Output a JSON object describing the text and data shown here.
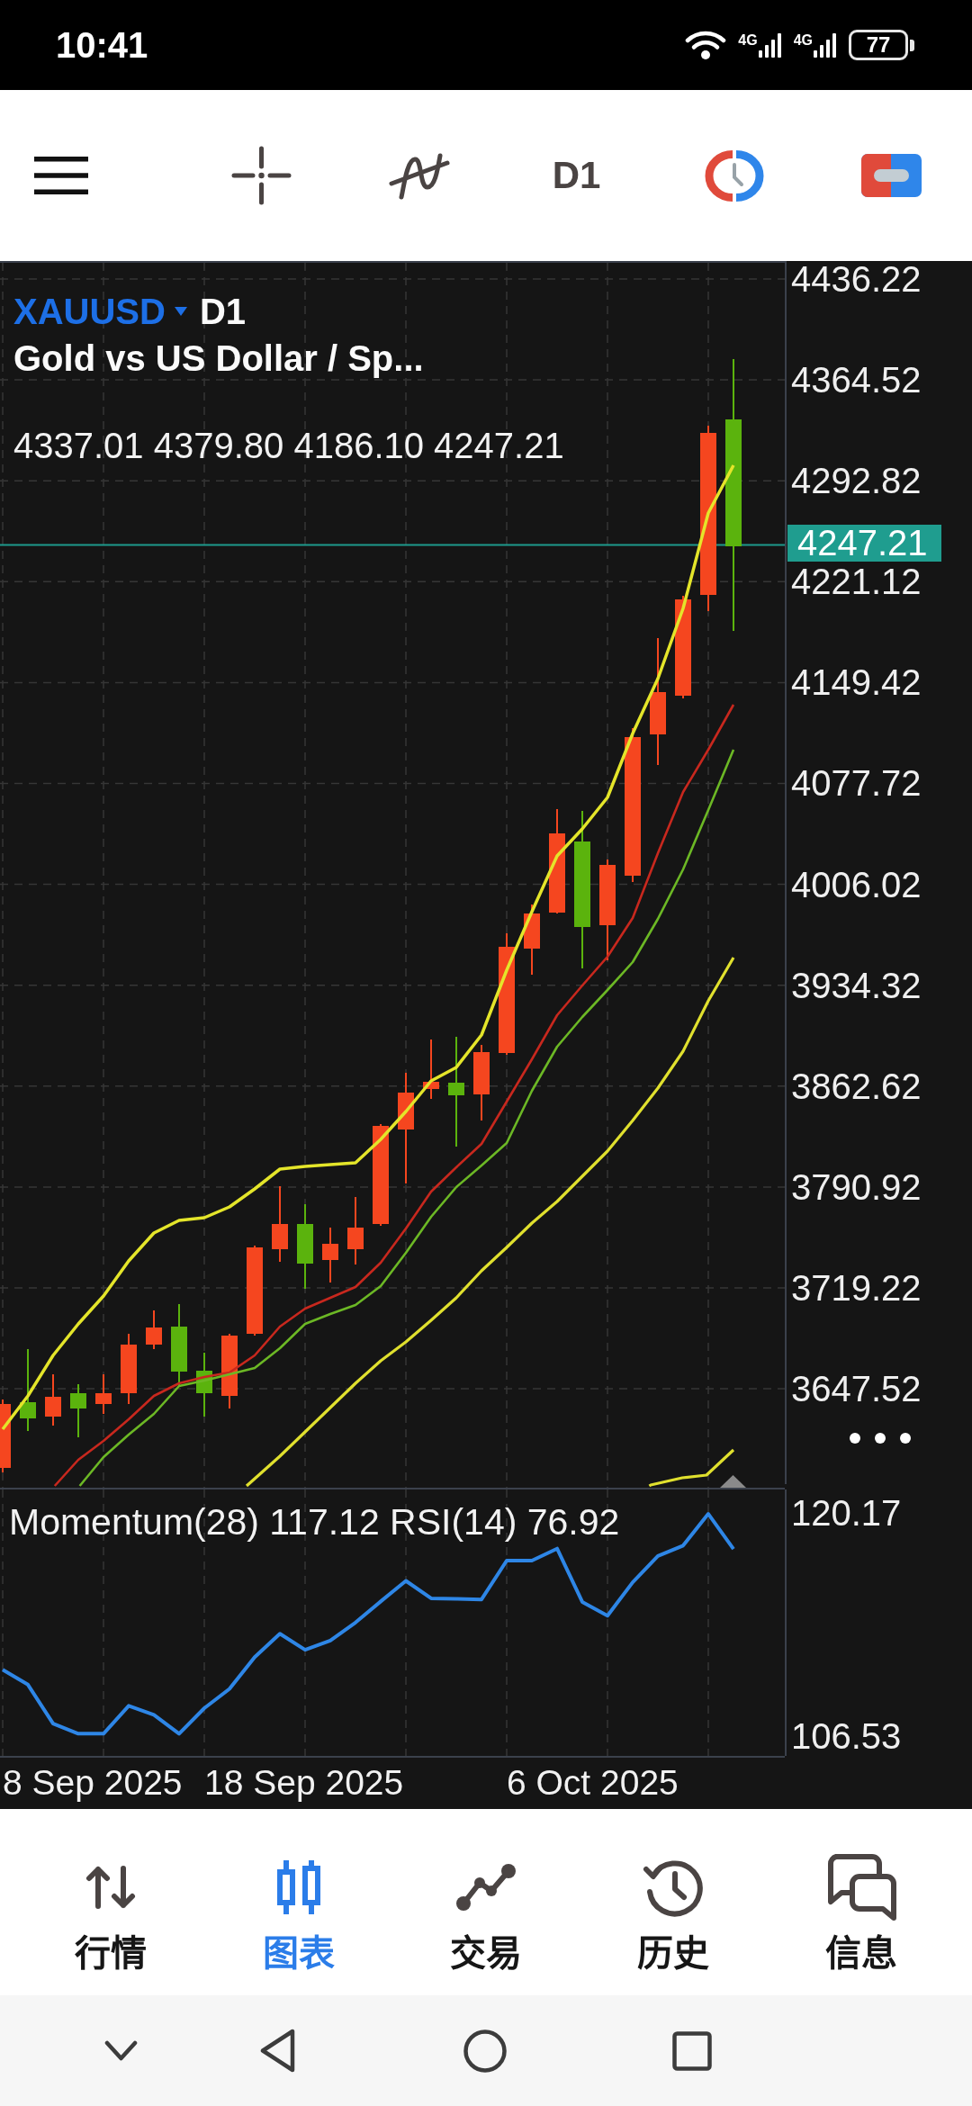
{
  "status_bar": {
    "time": "10:41",
    "signals": [
      {
        "network": "4G"
      },
      {
        "network": "4G"
      }
    ],
    "battery": "77"
  },
  "toolbar": {
    "timeframe": "D1"
  },
  "chart": {
    "symbol": "XAUUSD",
    "timeframe": "D1",
    "description": "Gold vs US Dollar / Sp...",
    "ohlc": "4337.01 4379.80 4186.10 4247.21",
    "price_axis": [
      "4436.22",
      "4364.52",
      "4292.82",
      "4221.12",
      "4149.42",
      "4077.72",
      "4006.02",
      "3934.32",
      "3862.62",
      "3790.92",
      "3719.22",
      "3647.52"
    ],
    "current_price": "4247.21"
  },
  "indicator": {
    "legend": "Momentum(28) 117.12 RSI(14) 76.92",
    "chart_data": {
      "type": "line",
      "series": [
        {
          "color": "#2e86e6",
          "values": [
            110.58,
            109.67,
            107.28,
            106.67,
            106.67,
            108.38,
            107.82,
            106.67,
            108.23,
            109.41,
            111.35,
            112.79,
            111.8,
            112.37,
            113.47,
            114.76,
            116.02,
            114.95,
            114.92,
            114.88,
            117.26,
            117.26,
            117.99,
            114.73,
            113.89,
            115.93,
            117.54,
            118.18,
            120.12,
            117.97
          ]
        }
      ],
      "ylim": [
        105.31,
        121.61
      ],
      "yticks": [
        {
          "value": 120.17,
          "label": "120.17"
        },
        {
          "value": 106.53,
          "label": "106.53"
        }
      ],
      "grid": true
    }
  },
  "time_axis": [
    "8 Sep 2025",
    "18 Sep 2025",
    "6 Oct 2025"
  ],
  "bottom_nav": [
    {
      "kind": "quotes",
      "label": "行情",
      "selected": false
    },
    {
      "kind": "chart",
      "label": "图表",
      "selected": true
    },
    {
      "kind": "trade",
      "label": "交易",
      "selected": false
    },
    {
      "kind": "history",
      "label": "历史",
      "selected": false
    },
    {
      "kind": "messages",
      "label": "信息",
      "selected": false
    }
  ]
}
